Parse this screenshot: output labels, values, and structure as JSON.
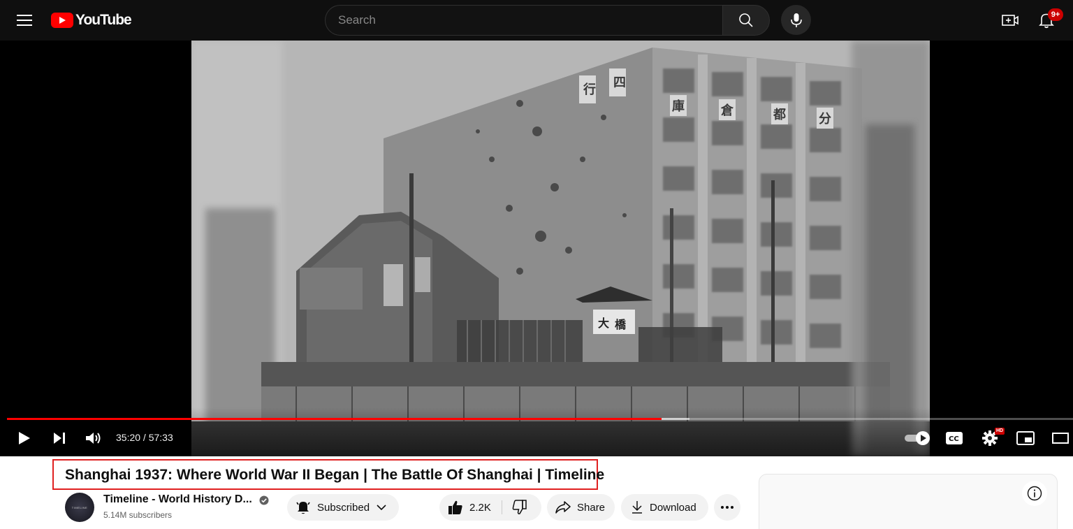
{
  "header": {
    "logo_text": "YouTube",
    "search_placeholder": "Search",
    "notification_count": "9+"
  },
  "icons": {
    "menu": "hamburger-menu-icon",
    "search": "search-icon",
    "mic": "microphone-icon",
    "create": "create-video-icon",
    "notifications": "bell-icon"
  },
  "player": {
    "current_time": "35:20",
    "duration": "57:33",
    "time_display": "35:20 / 57:33",
    "progress_fraction": 0.614,
    "loaded_fraction": 0.64,
    "hd_label": "HD",
    "frame_signs": [
      "四",
      "行",
      "庫",
      "倉",
      "都",
      "分",
      "大",
      "橋"
    ]
  },
  "video": {
    "title": "Shanghai 1937: Where World War II Began | The Battle Of Shanghai | Timeline"
  },
  "channel": {
    "name": "Timeline - World History D...",
    "subscribers": "5.14M subscribers",
    "avatar_text": "TIMELINE"
  },
  "actions": {
    "subscribe_label": "Subscribed",
    "like_count": "2.2K",
    "share_label": "Share",
    "download_label": "Download"
  },
  "colors": {
    "brand_red": "#ff0000",
    "topbar_bg": "#0f0f0f",
    "highlight_box": "#e02020"
  }
}
